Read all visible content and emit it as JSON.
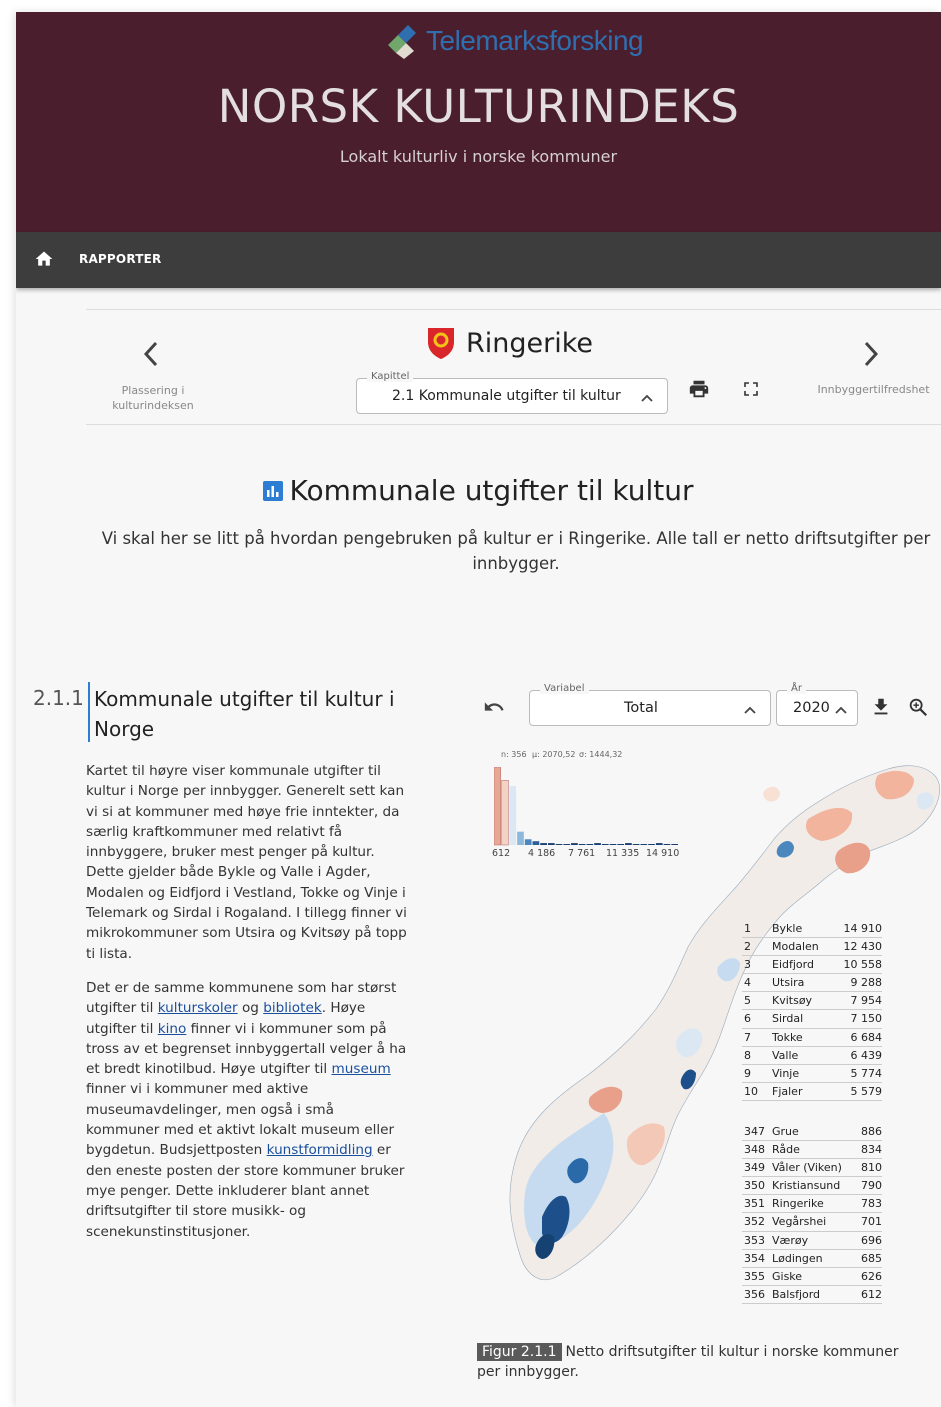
{
  "banner": {
    "logo_text": "Telemarksforsking",
    "title": "NORSK KULTURINDEKS",
    "subtitle": "Lokalt kulturliv i norske kommuner"
  },
  "navbar": {
    "reports_label": "RAPPORTER"
  },
  "chapter_nav": {
    "prev_label_line1": "Plassering i",
    "prev_label_line2": "kulturindeksen",
    "municipality": "Ringerike",
    "chapter_legend": "Kapittel",
    "chapter_value": "2.1 Kommunale utgifter til kultur",
    "next_label": "Innbyggertilfredshet"
  },
  "chapter": {
    "title": "Kommunale utgifter til kultur",
    "intro": "Vi skal her se litt på hvordan pengebruken på kultur er i Ringerike. Alle tall er netto driftsutgifter per innbygger."
  },
  "section": {
    "number": "2.1.1",
    "title": "Kommunale utgifter til kultur i Norge",
    "p1": "Kartet til høyre viser kommunale utgifter til kultur i Norge per innbygger. Generelt sett kan vi si at kommuner med høye frie inntekter, da særlig kraftkommuner med relativt få innbyggere, bruker mest penger på kultur. Dette gjelder både Bykle og Valle i Agder, Modalen og Eidfjord i Vestland, Tokke og Vinje i Telemark og Sirdal i Rogaland. I tillegg finner vi mikrokommuner som Utsira og Kvitsøy på topp ti lista.",
    "p2_a": "Det er de samme kommunene som har størst utgifter til ",
    "link_kulturskoler": "kulturskoler",
    "p2_b": " og ",
    "link_bibliotek": "bibliotek",
    "p2_c": ". Høye utgifter til ",
    "link_kino": "kino",
    "p2_d": " finner vi i kommuner som på tross av et begrenset innbyggertall velger å ha et bredt kinotilbud. Høye utgifter til ",
    "link_museum": "museum",
    "p2_e": " finner vi i kommuner med aktive museumavdelinger, men også i små kommuner med et aktivt lokalt museum eller bygdetun. Budsjettposten ",
    "link_kunstformidling": "kunstformidling",
    "p2_f": " er den eneste posten der store kommuner bruker mye penger. Dette inkluderer blant annet driftsutgifter til store musikk- og scenekunstinstitusjoner."
  },
  "figure": {
    "variable_legend": "Variabel",
    "variable_value": "Total",
    "year_legend": "År",
    "year_value": "2020",
    "caption_label": "Figur 2.1.1",
    "caption_text": "Netto driftsutgifter til kultur i norske kommuner per innbygger."
  },
  "chart_data": {
    "type": "bar",
    "stats": {
      "n": "n: 356",
      "mean": "μ: 2070,52",
      "sd": "σ: 1444,32"
    },
    "tick_labels": [
      "612",
      "4 186",
      "7 761",
      "11 335",
      "14 910"
    ],
    "values": [
      41,
      34,
      31,
      7,
      3,
      2,
      1,
      1,
      0,
      0,
      1,
      0,
      0,
      1,
      0,
      0,
      0,
      1,
      0,
      0,
      0,
      1,
      0,
      0
    ],
    "colors": [
      "#e6a793",
      "#f4d3c4",
      "#dbe8f3",
      "#8db9dc",
      "#4b86bd",
      "#2c5f98",
      "#1a3f72",
      "#1a3f72"
    ],
    "top10": [
      {
        "rank": "1",
        "name": "Bykle",
        "value": "14 910"
      },
      {
        "rank": "2",
        "name": "Modalen",
        "value": "12 430"
      },
      {
        "rank": "3",
        "name": "Eidfjord",
        "value": "10 558"
      },
      {
        "rank": "4",
        "name": "Utsira",
        "value": "9 288"
      },
      {
        "rank": "5",
        "name": "Kvitsøy",
        "value": "7 954"
      },
      {
        "rank": "6",
        "name": "Sirdal",
        "value": "7 150"
      },
      {
        "rank": "7",
        "name": "Tokke",
        "value": "6 684"
      },
      {
        "rank": "8",
        "name": "Valle",
        "value": "6 439"
      },
      {
        "rank": "9",
        "name": "Vinje",
        "value": "5 774"
      },
      {
        "rank": "10",
        "name": "Fjaler",
        "value": "5 579"
      }
    ],
    "bottom10": [
      {
        "rank": "347",
        "name": "Grue",
        "value": "886"
      },
      {
        "rank": "348",
        "name": "Råde",
        "value": "834"
      },
      {
        "rank": "349",
        "name": "Våler (Viken)",
        "value": "810"
      },
      {
        "rank": "350",
        "name": "Kristiansund",
        "value": "790"
      },
      {
        "rank": "351",
        "name": "Ringerike",
        "value": "783"
      },
      {
        "rank": "352",
        "name": "Vegårshei",
        "value": "701"
      },
      {
        "rank": "353",
        "name": "Værøy",
        "value": "696"
      },
      {
        "rank": "354",
        "name": "Lødingen",
        "value": "685"
      },
      {
        "rank": "355",
        "name": "Giske",
        "value": "626"
      },
      {
        "rank": "356",
        "name": "Balsfjord",
        "value": "612"
      }
    ]
  }
}
